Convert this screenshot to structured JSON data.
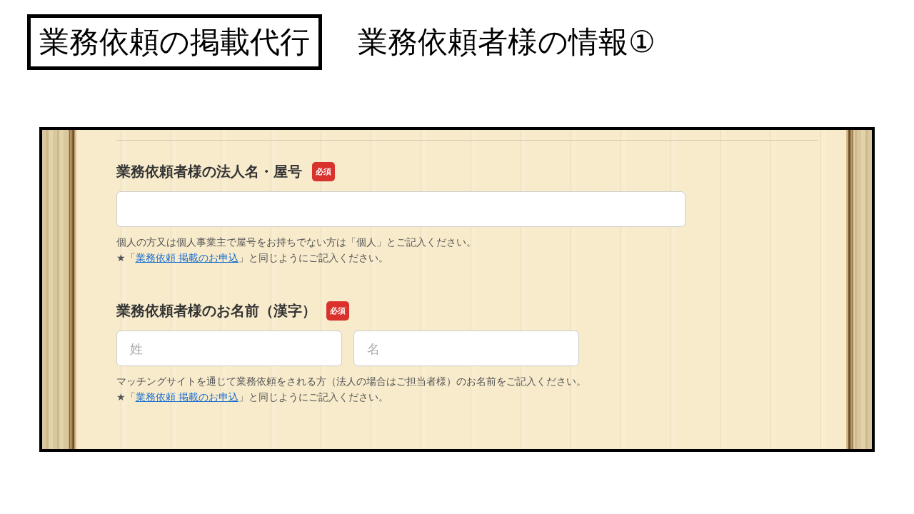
{
  "slide_title": {
    "boxed": "業務依頼の掲載代行",
    "subtitle": "業務依頼者様の情報①"
  },
  "sections": [
    {
      "label": "業務依頼者様の法人名・屋号",
      "badge": "必須",
      "inputs": [
        {
          "kind": "full"
        }
      ],
      "help": "個人の方又は個人事業主で屋号をお持ちでない方は「個人」とご記入ください。",
      "note": {
        "before": "★「",
        "link": "業務依頼 掲載のお申込",
        "after": "」と同じようにご記入ください。"
      }
    },
    {
      "label": "業務依頼者様のお名前（漢字）",
      "badge": "必須",
      "inputs": [
        {
          "kind": "half",
          "placeholder": "姓"
        },
        {
          "kind": "half",
          "placeholder": "名"
        }
      ],
      "help": "マッチングサイトを通じて業務依頼をされる方（法人の場合はご担当者様）のお名前をご記入ください。",
      "note": {
        "before": "★「",
        "link": "業務依頼 掲載のお申込",
        "after": "」と同じようにご記入ください。"
      }
    }
  ]
}
